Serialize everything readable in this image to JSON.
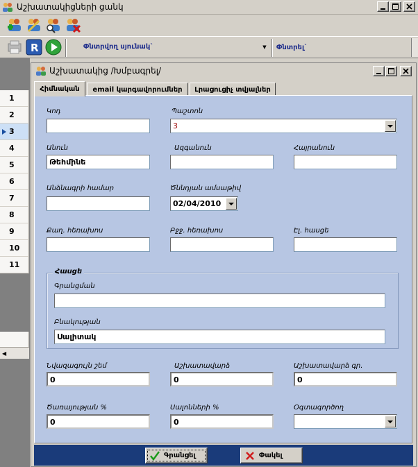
{
  "window": {
    "title": "Աշխատակիցների ցանկ"
  },
  "toolbar2": {
    "column_combo_label": "Փնտրվող սյունակ`",
    "filter_label": "Փնտրել`"
  },
  "grid": {
    "rows": [
      "1",
      "2",
      "3",
      "4",
      "5",
      "6",
      "7",
      "8",
      "9",
      "10",
      "11"
    ],
    "selected_row": "3"
  },
  "child": {
    "title": "Աշխատակից /Խմբագրել/",
    "tabs": [
      {
        "label": "Հիմնական"
      },
      {
        "label": "email կարգավորումներ"
      },
      {
        "label": "Լրացուցիչ տվյալներ"
      }
    ]
  },
  "form": {
    "code": {
      "label": "Կոդ",
      "value": ""
    },
    "position": {
      "label": "Պաշտոն",
      "value": "3"
    },
    "first_name": {
      "label": "Անուն",
      "value": "Թեհմինե"
    },
    "last_name": {
      "label": "Ազգանուն",
      "value": ""
    },
    "middle_name": {
      "label": "Հայրանուն",
      "value": ""
    },
    "passport": {
      "label": "Անձնագրի համար",
      "value": ""
    },
    "birth_date": {
      "label": "Ծննդյան ամսաթիվ",
      "value": "02/04/2010"
    },
    "home_phone": {
      "label": "Քաղ. հեռախոս",
      "value": ""
    },
    "mobile_phone": {
      "label": "Բջջ. հեռախոս",
      "value": ""
    },
    "email": {
      "label": "Էլ. հասցե",
      "value": ""
    },
    "address_group": {
      "title": "Հասցե",
      "registration": {
        "label": "Գրանցման",
        "value": ""
      },
      "residence": {
        "label": "Բնակության",
        "value": "Սալիտակ"
      }
    },
    "min_salary": {
      "label": "Նվազագույն շեմ",
      "value": "0"
    },
    "salary": {
      "label": "Աշխատավարձ",
      "value": "0"
    },
    "salary_gr": {
      "label": "Աշխատավարձ գր.",
      "value": "0"
    },
    "service_pct": {
      "label": "Ծառայության %",
      "value": "0"
    },
    "sales_pct": {
      "label": "Սալոնների %",
      "value": "0"
    },
    "user": {
      "label": "Օգտագործող",
      "value": ""
    }
  },
  "footer": {
    "save_label": "Գրանցել",
    "close_label": "Փակել"
  },
  "colors": {
    "panel_bg": "#b7c6e3",
    "footer_bg": "#1a3b7a",
    "accent_text": "#1f2e8c"
  }
}
